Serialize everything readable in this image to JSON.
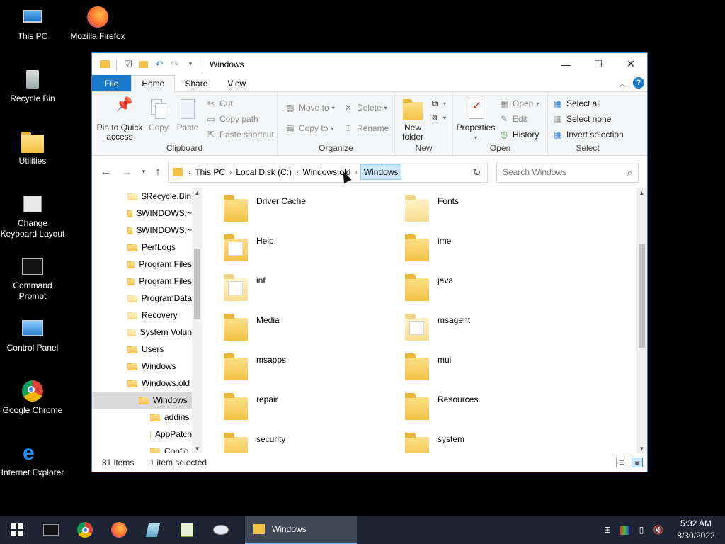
{
  "desktop": {
    "icons": [
      {
        "label": "This PC"
      },
      {
        "label": "Mozilla Firefox"
      },
      {
        "label": "Recycle Bin"
      },
      {
        "label": "Utilities"
      },
      {
        "label": "Change\nKeyboard Layout"
      },
      {
        "label": "Command\nPrompt"
      },
      {
        "label": "Control Panel"
      },
      {
        "label": "Google Chrome"
      },
      {
        "label": "Internet Explorer"
      }
    ]
  },
  "window": {
    "title": "Windows",
    "controls": {
      "minimize": "—",
      "maximize": "☐",
      "close": "✕"
    }
  },
  "ribbon_tabs": {
    "file": "File",
    "home": "Home",
    "share": "Share",
    "view": "View"
  },
  "ribbon": {
    "clipboard": {
      "label": "Clipboard",
      "pin": "Pin to Quick access",
      "copy": "Copy",
      "paste": "Paste",
      "cut": "Cut",
      "copy_path": "Copy path",
      "paste_shortcut": "Paste shortcut"
    },
    "organize": {
      "label": "Organize",
      "move_to": "Move to",
      "copy_to": "Copy to",
      "delete": "Delete",
      "rename": "Rename"
    },
    "new": {
      "label": "New",
      "new_folder": "New folder"
    },
    "open": {
      "label": "Open",
      "properties": "Properties",
      "open": "Open",
      "edit": "Edit",
      "history": "History"
    },
    "select": {
      "label": "Select",
      "select_all": "Select all",
      "select_none": "Select none",
      "invert": "Invert selection"
    }
  },
  "address": {
    "crumbs": [
      "This PC",
      "Local Disk (C:)",
      "Windows.old",
      "Windows"
    ],
    "search_placeholder": "Search Windows"
  },
  "tree": [
    {
      "label": "$Recycle.Bin",
      "indent": 0,
      "pale": true
    },
    {
      "label": "$WINDOWS.~",
      "indent": 0,
      "pale": false
    },
    {
      "label": "$WINDOWS.~",
      "indent": 0,
      "pale": false
    },
    {
      "label": "PerfLogs",
      "indent": 0,
      "pale": false
    },
    {
      "label": "Program Files",
      "indent": 0,
      "pale": false
    },
    {
      "label": "Program Files",
      "indent": 0,
      "pale": false
    },
    {
      "label": "ProgramData",
      "indent": 0,
      "pale": true
    },
    {
      "label": "Recovery",
      "indent": 0,
      "pale": true
    },
    {
      "label": "System Volun",
      "indent": 0,
      "pale": true
    },
    {
      "label": "Users",
      "indent": 0,
      "pale": false
    },
    {
      "label": "Windows",
      "indent": 0,
      "pale": false
    },
    {
      "label": "Windows.old",
      "indent": 0,
      "pale": false
    },
    {
      "label": "Windows",
      "indent": 1,
      "pale": false,
      "selected": true
    },
    {
      "label": "addins",
      "indent": 2,
      "pale": false
    },
    {
      "label": "AppPatch",
      "indent": 2,
      "pale": false
    },
    {
      "label": "Config",
      "indent": 2,
      "pale": false
    }
  ],
  "files": [
    {
      "name": "Driver Cache",
      "pale": false
    },
    {
      "name": "Fonts",
      "pale": true
    },
    {
      "name": "Help",
      "pale": false,
      "doc": true
    },
    {
      "name": "ime",
      "pale": false
    },
    {
      "name": "inf",
      "pale": true,
      "doc": true
    },
    {
      "name": "java",
      "pale": false
    },
    {
      "name": "Media",
      "pale": false
    },
    {
      "name": "msagent",
      "pale": true,
      "doc": true
    },
    {
      "name": "msapps",
      "pale": false
    },
    {
      "name": "mui",
      "pale": false
    },
    {
      "name": "repair",
      "pale": false
    },
    {
      "name": "Resources",
      "pale": false
    },
    {
      "name": "security",
      "pale": false
    },
    {
      "name": "system",
      "pale": false
    }
  ],
  "status": {
    "items": "31 items",
    "selected": "1 item selected"
  },
  "taskbar": {
    "active_app": "Windows",
    "time": "5:32 AM",
    "date": "8/30/2022"
  }
}
